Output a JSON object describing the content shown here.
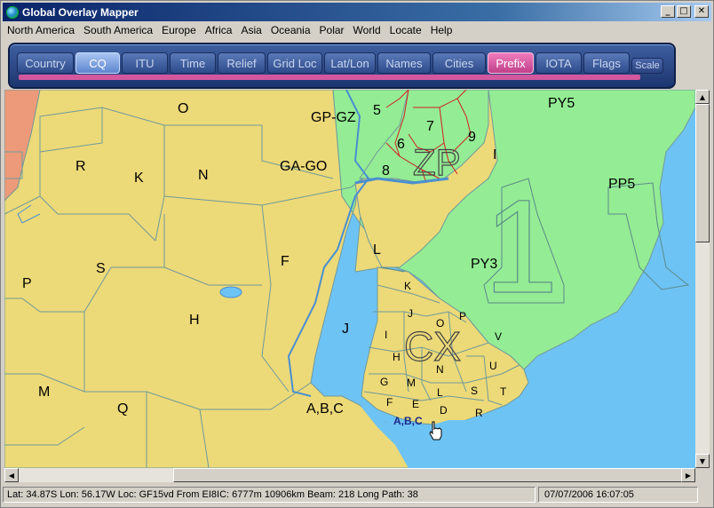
{
  "window": {
    "title": "Global Overlay Mapper"
  },
  "title_controls": {
    "minimize": "_",
    "maximize": "□",
    "close": "✕"
  },
  "menu": [
    "North America",
    "South America",
    "Europe",
    "Africa",
    "Asia",
    "Oceania",
    "Polar",
    "World",
    "Locate",
    "Help"
  ],
  "tabs": [
    {
      "label": "Country",
      "state": "normal"
    },
    {
      "label": "CQ",
      "state": "active"
    },
    {
      "label": "ITU",
      "state": "normal"
    },
    {
      "label": "Time",
      "state": "normal"
    },
    {
      "label": "Relief",
      "state": "normal"
    },
    {
      "label": "Grid Loc",
      "state": "normal"
    },
    {
      "label": "Lat/Lon",
      "state": "normal"
    },
    {
      "label": "Names",
      "state": "normal"
    },
    {
      "label": "Cities",
      "state": "normal"
    },
    {
      "label": "Prefix",
      "state": "selected"
    },
    {
      "label": "IOTA",
      "state": "normal"
    },
    {
      "label": "Flags",
      "state": "normal"
    }
  ],
  "scale_button": "Scale",
  "colors": {
    "argentina": "#ecd978",
    "brazil": "#94ec94",
    "sea": "#6ec3f5",
    "chile": "#ec9a7a",
    "border": "#6f9a9a",
    "province": "#d02020",
    "accent": "#d2589e"
  },
  "map": {
    "labels": {
      "o": "O",
      "gpgz": "GP-GZ",
      "five": "5",
      "py5": "PY5",
      "seven": "7",
      "six": "6",
      "nine": "9",
      "zp": "ZP",
      "i_br": "I",
      "eight": "8",
      "r": "R",
      "k_ar": "K",
      "n_ar": "N",
      "gago": "GA-GO",
      "pp5": "PP5",
      "one": "1",
      "l_ar": "L",
      "f_ar": "F",
      "py3": "PY3",
      "s_ar": "S",
      "p_ar": "P",
      "h_ar": "H",
      "j_ar": "J",
      "m_ar": "M",
      "q_ar": "Q",
      "abc": "A,B,C",
      "cx": "CX",
      "cx_k": "K",
      "cx_j": "J",
      "cx_o": "O",
      "cx_p": "P",
      "cx_i": "I",
      "cx_v": "V",
      "cx_h": "H",
      "cx_n": "N",
      "cx_u": "U",
      "cx_g": "G",
      "cx_m": "M",
      "cx_l": "L",
      "cx_s": "S",
      "cx_t": "T",
      "cx_f": "F",
      "cx_e": "E",
      "cx_d": "D",
      "cx_r": "R",
      "cx_abc": "A,B,C"
    }
  },
  "status": {
    "text": "Lat: 34.87S  Lon: 56.17W  Loc: GF15vd  From EI8IC: 6777m  10906km  Beam: 218  Long Path: 38",
    "datetime": "07/07/2006 16:07:05"
  }
}
